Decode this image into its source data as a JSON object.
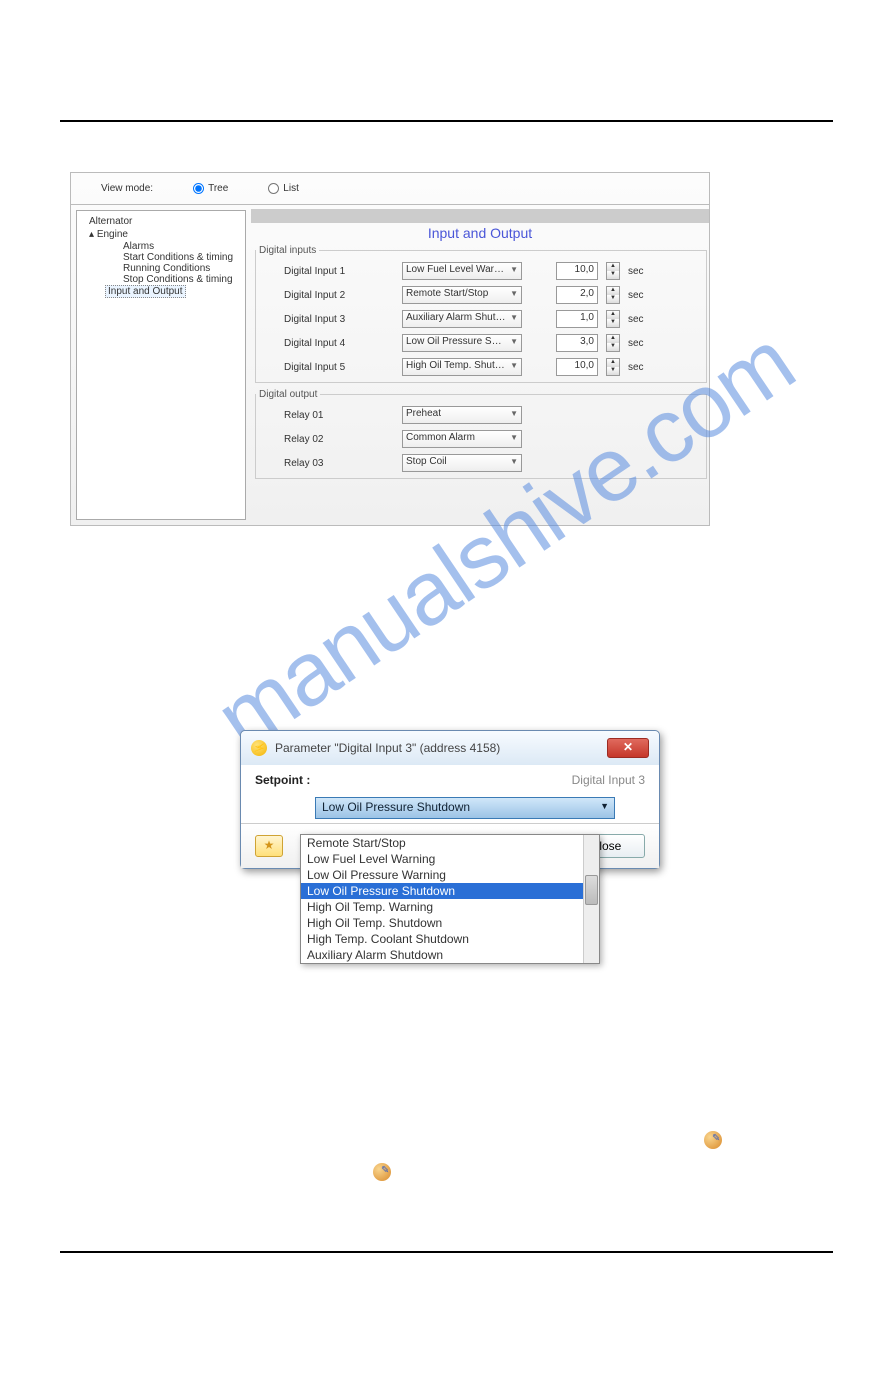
{
  "viewmode": {
    "label": "View mode:",
    "tree": "Tree",
    "list": "List"
  },
  "tree": {
    "alternator": "Alternator",
    "engine": "Engine",
    "alarms": "Alarms",
    "start": "Start Conditions & timing",
    "running": "Running Conditions",
    "stop": "Stop Conditions & timing",
    "io": "Input and Output"
  },
  "content": {
    "title": "Input and Output",
    "digital_inputs_legend": "Digital inputs",
    "digital_output_legend": "Digital output",
    "unit": "sec",
    "inputs": [
      {
        "label": "Digital Input 1",
        "value": "Low Fuel Level Warning",
        "num": "10,0"
      },
      {
        "label": "Digital Input 2",
        "value": "Remote Start/Stop",
        "num": "2,0"
      },
      {
        "label": "Digital Input 3",
        "value": "Auxiliary Alarm Shutdown",
        "num": "1,0"
      },
      {
        "label": "Digital Input 4",
        "value": "Low Oil Pressure Shutdow",
        "num": "3,0"
      },
      {
        "label": "Digital Input 5",
        "value": "High Oil Temp. Shutdown",
        "num": "10,0"
      }
    ],
    "outputs": [
      {
        "label": "Relay 01",
        "value": "Preheat"
      },
      {
        "label": "Relay 02",
        "value": "Common Alarm"
      },
      {
        "label": "Relay 03",
        "value": "Stop Coil"
      }
    ]
  },
  "dialog": {
    "title": "Parameter \"Digital Input 3\" (address 4158)",
    "setpoint": "Setpoint :",
    "param_name": "Digital Input 3",
    "selected": "Low Oil Pressure Shutdown",
    "close": "Close",
    "options": [
      "Remote Start/Stop",
      "Low Fuel Level Warning",
      "Low Oil Pressure Warning",
      "Low Oil Pressure Shutdown",
      "High Oil Temp. Warning",
      "High Oil Temp. Shutdown",
      "High Temp. Coolant Shutdown",
      "Auxiliary Alarm Shutdown"
    ],
    "highlight_index": 3
  },
  "watermark": "manualshive.com"
}
